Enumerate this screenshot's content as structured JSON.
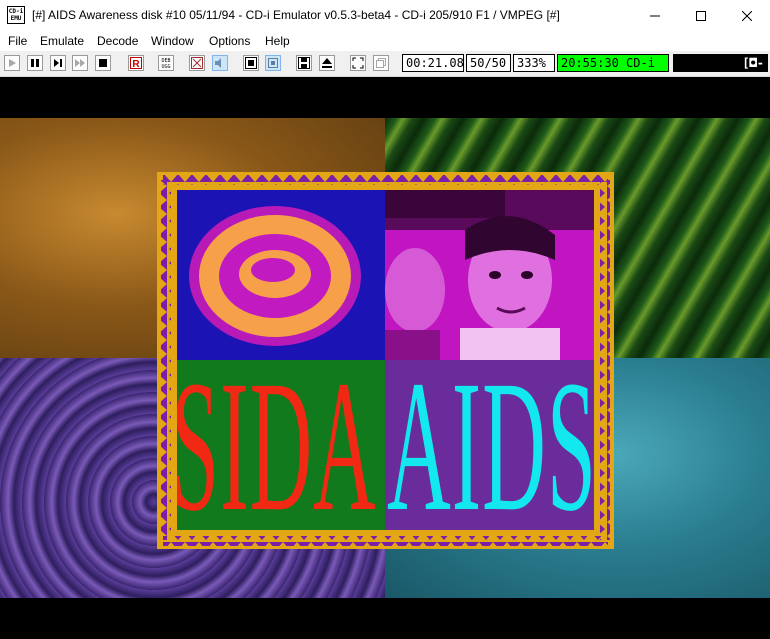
{
  "window": {
    "title": "[#] AIDS Awareness disk #10 05/11/94 - CD-i Emulator v0.5.3-beta4 - CD-i 205/910 F1 / VMPEG [#]",
    "icon_text": "CD-i EMU"
  },
  "menu": [
    "File",
    "Emulate",
    "Decode",
    "Window",
    "Options",
    "Help"
  ],
  "toolbar": {
    "time": "00:21.08",
    "fields": "50/50",
    "speed": "333%",
    "clock": "20:55:30 CD-i",
    "status_display": "[◘-"
  },
  "artwork": {
    "word_left": "SIDA",
    "word_right": "AIDS"
  },
  "colors": {
    "frame": "#e3a615",
    "triangles": "#7b1ea8",
    "panel_blue": "#1b13b4",
    "panel_magenta": "#c015c0",
    "panel_green": "#107a1c",
    "panel_purple": "#6a2c9a",
    "text_red": "#f02814",
    "text_cyan": "#12e8ee",
    "clock_green": "#00ff00"
  }
}
